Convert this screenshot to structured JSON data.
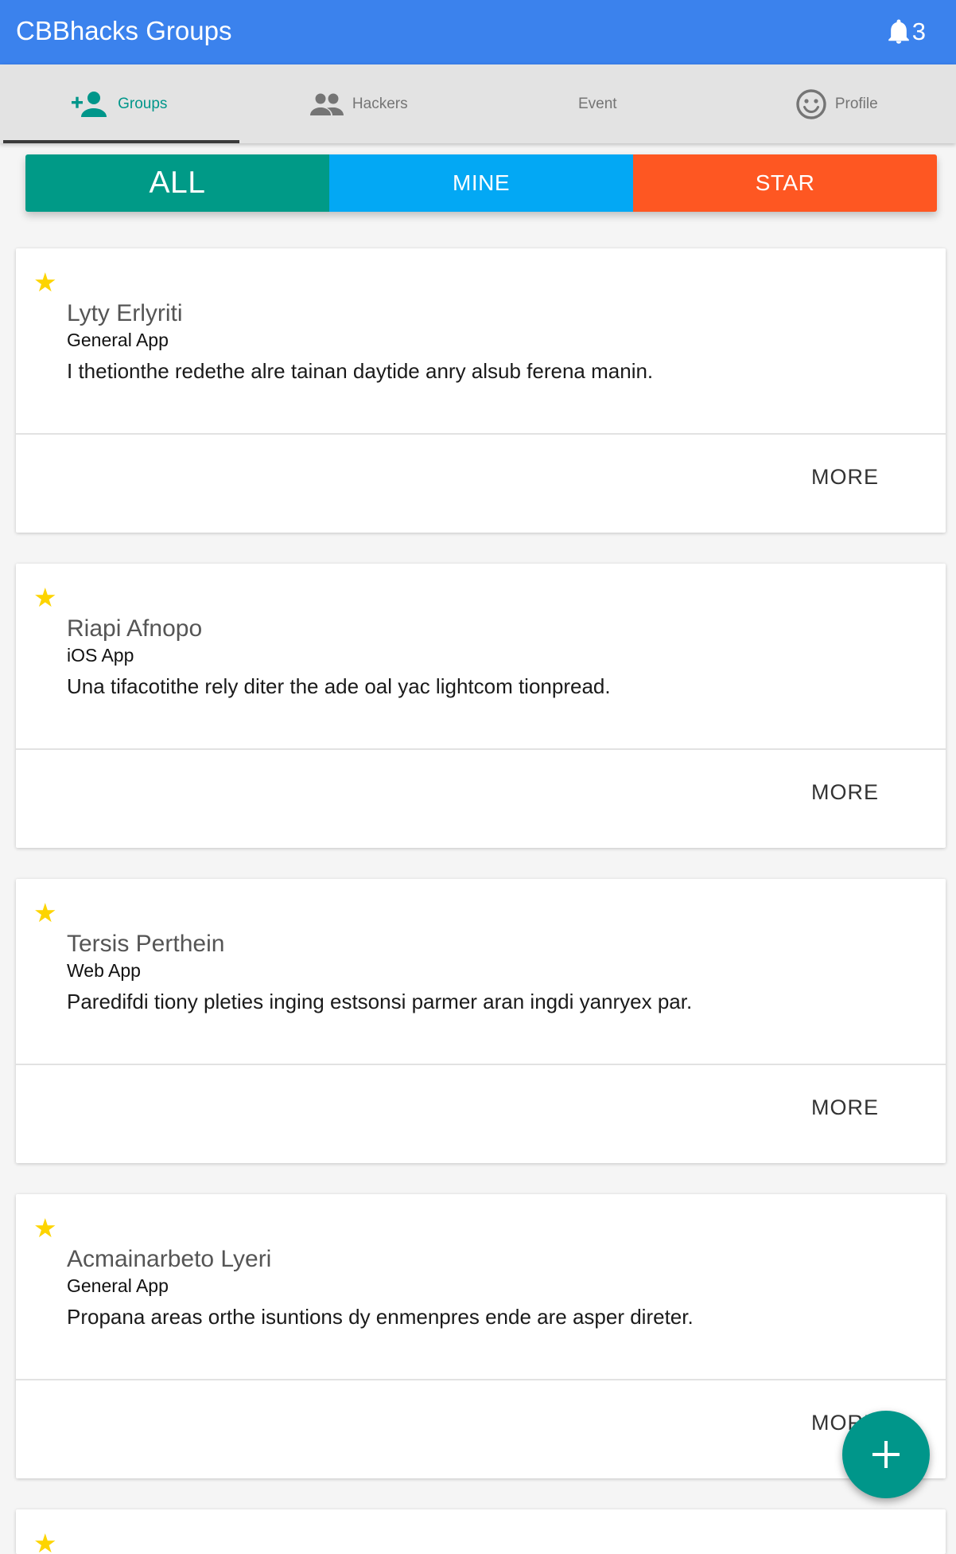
{
  "appbar": {
    "title": "CBBhacks Groups",
    "notification_icon": "bell-icon",
    "notification_count": "3"
  },
  "tabs": [
    {
      "label": "Groups",
      "icon": "person-add-icon",
      "active": true
    },
    {
      "label": "Hackers",
      "icon": "people-icon",
      "active": false
    },
    {
      "label": "Event",
      "icon": "",
      "active": false
    },
    {
      "label": "Profile",
      "icon": "smiley-face-icon",
      "active": false
    }
  ],
  "filters": {
    "all": "ALL",
    "mine": "MINE",
    "star": "STAR"
  },
  "groups": [
    {
      "star": "★",
      "name": "Lyty Erlyriti",
      "kind": "General App",
      "description": "I thetionthe redethe alre tainan daytide anry alsub ferena manin.",
      "more": "MORE"
    },
    {
      "star": "★",
      "name": "Riapi Afnopo",
      "kind": "iOS App",
      "description": "Una tifacotithe rely diter the ade oal yac lightcom tionpread.",
      "more": "MORE"
    },
    {
      "star": "★",
      "name": "Tersis Perthein",
      "kind": "Web App",
      "description": "Paredifdi tiony pleties inging estsonsi parmer aran ingdi yanryex par.",
      "more": "MORE"
    },
    {
      "star": "★",
      "name": "Acmainarbeto Lyeri",
      "kind": "General App",
      "description": "Propana areas orthe isuntions dy enmenpres ende are asper direter.",
      "more": "MORE"
    },
    {
      "star": "★"
    }
  ],
  "fab": {
    "icon": "plus-icon"
  },
  "colors": {
    "appbar": "#3b82ed",
    "accent": "#00968a",
    "mine": "#03a8f4",
    "star_filter": "#fe5722",
    "star_icon": "#fdd400"
  }
}
